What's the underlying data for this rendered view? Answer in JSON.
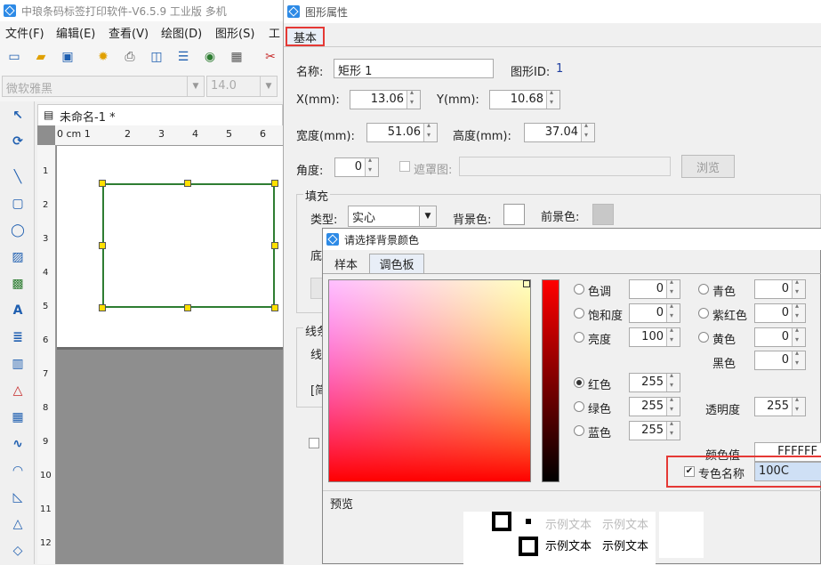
{
  "main_window": {
    "title": "中琅条码标签打印软件-V6.5.9 工业版 多机",
    "menu": [
      "文件(F)",
      "编辑(E)",
      "查看(V)",
      "绘图(D)",
      "图形(S)",
      "工"
    ],
    "font_name": "微软雅黑",
    "font_size": "14.0",
    "doc_tab": "未命名-1 *",
    "ruler_unit_label": "0 cm 1",
    "ruler_ticks": [
      "2",
      "3",
      "4",
      "5",
      "6"
    ],
    "ruler_left_ticks": [
      "1",
      "2",
      "3",
      "4",
      "5",
      "6",
      "7",
      "8",
      "9",
      "10",
      "11",
      "12"
    ]
  },
  "prop_dialog": {
    "title": "图形属性",
    "tab_basic": "基本",
    "name_label": "名称:",
    "name_value": "矩形 1",
    "shape_id_label": "图形ID:",
    "shape_id_value": "1",
    "x_label": "X(mm):",
    "x_value": "13.06",
    "y_label": "Y(mm):",
    "y_value": "10.68",
    "width_label": "宽度(mm):",
    "width_value": "51.06",
    "height_label": "高度(mm):",
    "height_value": "37.04",
    "angle_label": "角度:",
    "angle_value": "0",
    "mask_label": "遮罩图:",
    "browse_button": "浏览",
    "fill_group": "填充",
    "type_label": "类型:",
    "type_value": "实心",
    "bg_color_label": "背景色:",
    "fg_color_label": "前景色:",
    "partial_label_di": "底",
    "line_group_partial": "线条",
    "line_partial_1": "线",
    "line_partial_2": "[简"
  },
  "color_dialog": {
    "title": "请选择背景颜色",
    "tab_sample": "样本",
    "tab_palette": "调色板",
    "hue_label": "色调",
    "hue_value": "0",
    "saturation_label": "饱和度",
    "saturation_value": "0",
    "brightness_label": "亮度",
    "brightness_value": "100",
    "cyan_label": "青色",
    "cyan_value": "0",
    "magenta_label": "紫红色",
    "magenta_value": "0",
    "yellow_label": "黄色",
    "yellow_value": "0",
    "black_label": "黑色",
    "black_value": "0",
    "red_label": "红色",
    "red_value": "255",
    "green_label": "绿色",
    "green_value": "255",
    "blue_label": "蓝色",
    "blue_value": "255",
    "transparency_label": "透明度",
    "transparency_value": "255",
    "color_value_label": "颜色值",
    "color_value": "FFFFFF",
    "spot_color_label": "专色名称",
    "spot_color_value": "100C",
    "preview_label": "预览",
    "sample_text_1": "示例文本",
    "sample_text_2": "示例文本",
    "sample_text_3": "示例文本",
    "sample_text_4": "示例文本"
  },
  "colors": {
    "accent_red": "#e53935",
    "shape_border": "#2e7d32",
    "handle": "#ffe000",
    "brand_blue": "#2d8ae6"
  }
}
